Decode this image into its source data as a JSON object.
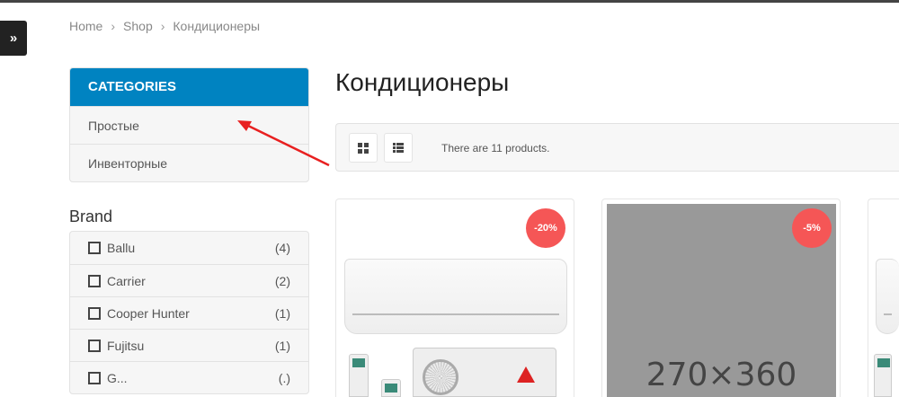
{
  "breadcrumb": [
    "Home",
    "Shop",
    "Кондиционеры"
  ],
  "categories": {
    "title": "CATEGORIES",
    "items": [
      "Простые",
      "Инвенторные"
    ]
  },
  "brand": {
    "title": "Brand",
    "items": [
      {
        "name": "Ballu",
        "count": "(4)"
      },
      {
        "name": "Carrier",
        "count": "(2)"
      },
      {
        "name": "Cooper Hunter",
        "count": "(1)"
      },
      {
        "name": "Fujitsu",
        "count": "(1)"
      },
      {
        "name": "G...",
        "count": "(.)"
      }
    ]
  },
  "page_title": "Кондиционеры",
  "toolbar": {
    "count_text": "There are 11 products."
  },
  "products": [
    {
      "badge": "-20%"
    },
    {
      "badge": "-5%",
      "placeholder": "270×360"
    },
    {}
  ],
  "colors": {
    "accent": "#0083c1",
    "badge": "#f55656",
    "annotation": "#e82020"
  }
}
